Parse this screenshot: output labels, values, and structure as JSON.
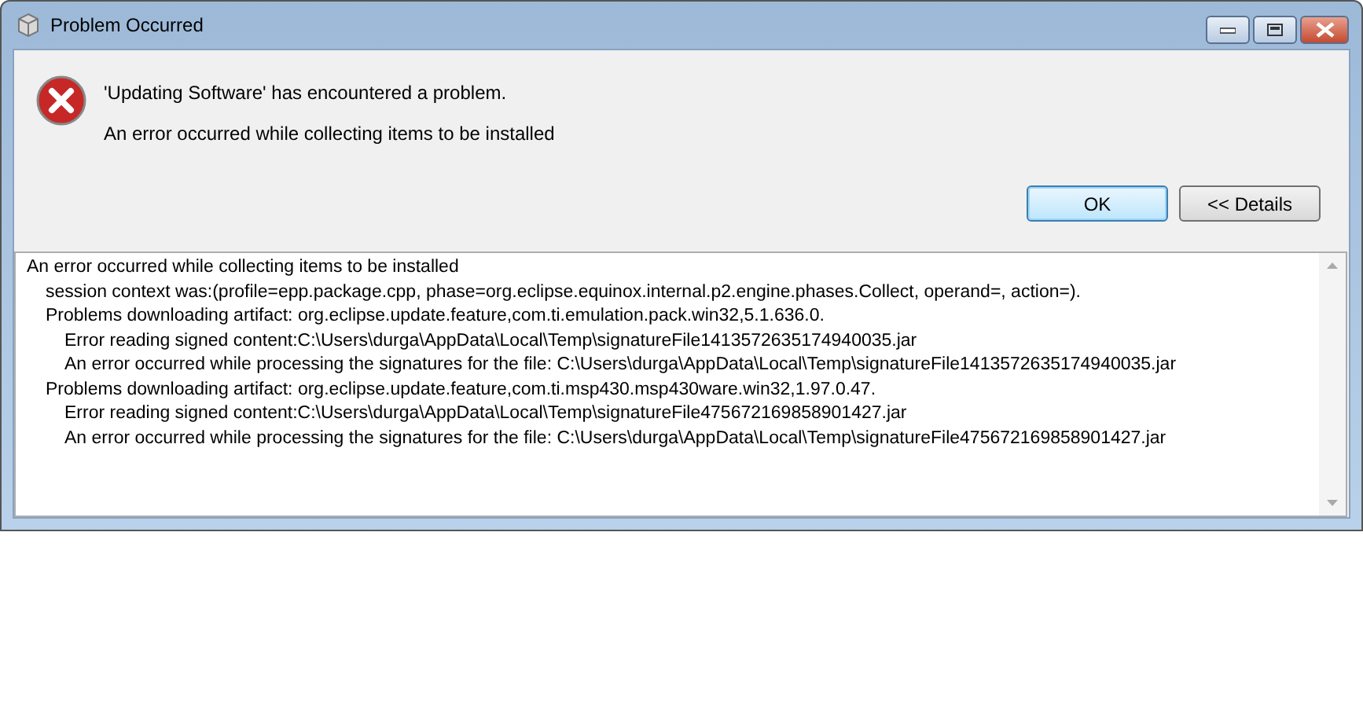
{
  "window": {
    "title": "Problem Occurred"
  },
  "message": {
    "heading": "'Updating Software' has encountered a problem.",
    "detail": "An error occurred while collecting items to be installed"
  },
  "buttons": [
    {
      "label": "OK",
      "default": true
    },
    {
      "label": "<< Details",
      "default": false
    }
  ],
  "details": [
    {
      "text": "An error occurred while collecting items to be installed",
      "children": [
        {
          "text": "session context was:(profile=epp.package.cpp, phase=org.eclipse.equinox.internal.p2.engine.phases.Collect, operand=, action=)."
        },
        {
          "text": "Problems downloading artifact: org.eclipse.update.feature,com.ti.emulation.pack.win32,5.1.636.0.",
          "children": [
            {
              "text": "Error reading signed content:C:\\Users\\durga\\AppData\\Local\\Temp\\signatureFile1413572635174940035.jar"
            },
            {
              "text": "An error occurred while processing the signatures for the file: C:\\Users\\durga\\AppData\\Local\\Temp\\signatureFile1413572635174940035.jar"
            }
          ]
        },
        {
          "text": "Problems downloading artifact: org.eclipse.update.feature,com.ti.msp430.msp430ware.win32,1.97.0.47.",
          "children": [
            {
              "text": "Error reading signed content:C:\\Users\\durga\\AppData\\Local\\Temp\\signatureFile475672169858901427.jar"
            },
            {
              "text": "An error occurred while processing the signatures for the file: C:\\Users\\durga\\AppData\\Local\\Temp\\signatureFile475672169858901427.jar"
            }
          ]
        }
      ]
    }
  ]
}
